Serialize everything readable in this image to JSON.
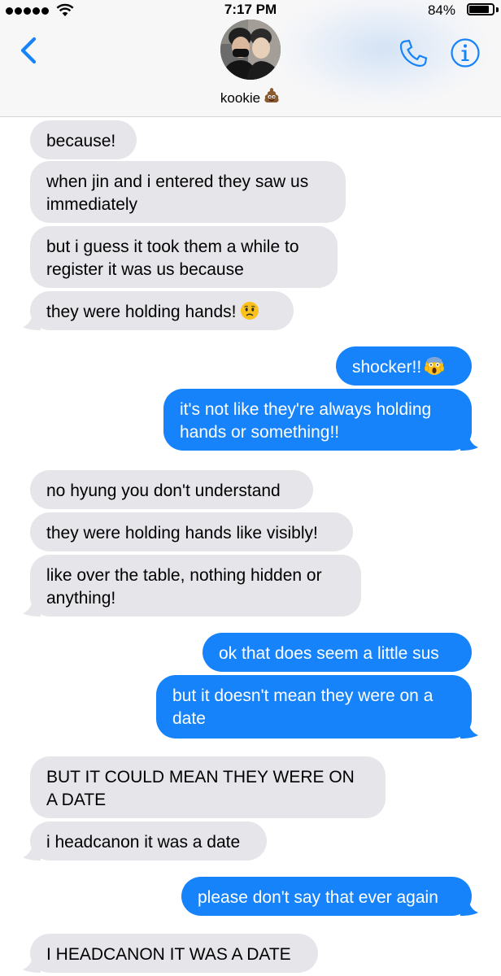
{
  "status_bar": {
    "time": "7:17 PM",
    "battery": "84%",
    "battery_level": 0.84
  },
  "header": {
    "contact_name": "kookie",
    "contact_emoji": "pile-of-poo-emoji",
    "back_icon": "chevron-left-icon",
    "phone_icon": "phone-icon",
    "info_icon": "info-icon",
    "accent_color": "#1683fb"
  },
  "messages": [
    {
      "side": "in",
      "text": "because!"
    },
    {
      "side": "in",
      "lines": [
        "when jin and i entered they saw us",
        "immediately"
      ]
    },
    {
      "side": "in",
      "lines": [
        "but i guess it took them a while to",
        "register it was us because"
      ]
    },
    {
      "side": "in",
      "text": "they were holding hands!",
      "emoji": "worried-face-emoji"
    },
    {
      "side": "out",
      "text": "shocker!!",
      "emoji": "screaming-face-emoji"
    },
    {
      "side": "out",
      "lines": [
        "it's not like they're always holding",
        "hands or something!!"
      ]
    },
    {
      "side": "in",
      "text": "no hyung you don't understand"
    },
    {
      "side": "in",
      "text": "they were holding hands like visibly!"
    },
    {
      "side": "in",
      "lines": [
        "like over the table, nothing hidden or",
        "anything!"
      ]
    },
    {
      "side": "out",
      "text": "ok that does seem a little sus"
    },
    {
      "side": "out",
      "lines": [
        "but it doesn't mean they were on a",
        "date"
      ]
    },
    {
      "side": "in",
      "lines": [
        "BUT IT COULD MEAN THEY WERE ON",
        "A DATE"
      ]
    },
    {
      "side": "in",
      "text": "i headcanon it was a date"
    },
    {
      "side": "out",
      "text": "please don't say that ever again"
    },
    {
      "side": "in",
      "text": "I HEADCANON IT WAS A DATE"
    }
  ],
  "colors": {
    "incoming_bubble": "#e5e5ea",
    "outgoing_bubble": "#1683fb"
  }
}
